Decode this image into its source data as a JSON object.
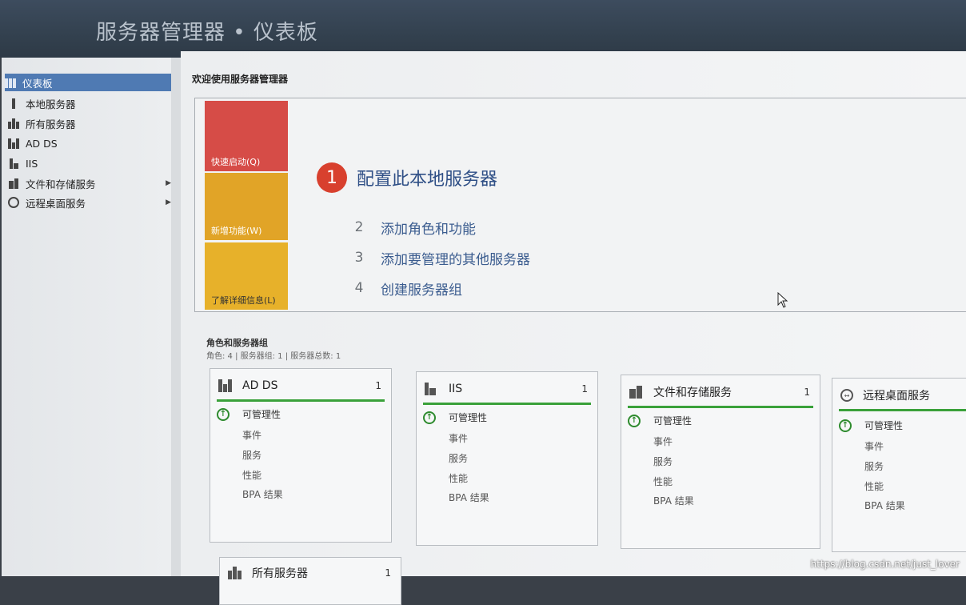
{
  "window": {
    "title": "服务器管理器 • 仪表板"
  },
  "sidebar": {
    "items": [
      {
        "label": "仪表板",
        "icon": "dashboard-icon",
        "active": true
      },
      {
        "label": "本地服务器",
        "icon": "server-icon"
      },
      {
        "label": "所有服务器",
        "icon": "servers-icon"
      },
      {
        "label": "AD DS",
        "icon": "ad-ds-icon"
      },
      {
        "label": "IIS",
        "icon": "iis-icon"
      },
      {
        "label": "文件和存储服务",
        "icon": "storage-icon",
        "expandable": true
      },
      {
        "label": "远程桌面服务",
        "icon": "remote-desktop-icon",
        "expandable": true
      }
    ]
  },
  "welcome": {
    "title": "欢迎使用服务器管理器",
    "tiles": [
      "快速启动(Q)",
      "新增功能(W)",
      "了解详细信息(L)"
    ],
    "steps": [
      {
        "num": "1",
        "label": "配置此本地服务器"
      },
      {
        "num": "2",
        "label": "添加角色和功能"
      },
      {
        "num": "3",
        "label": "添加要管理的其他服务器"
      },
      {
        "num": "4",
        "label": "创建服务器组"
      }
    ]
  },
  "roles": {
    "title": "角色和服务器组",
    "subtitle": "角色: 4 | 服务器组: 1 | 服务器总数: 1",
    "cards": [
      {
        "name": "AD DS",
        "count": "1",
        "rows": [
          "可管理性",
          "事件",
          "服务",
          "性能",
          "BPA 结果"
        ]
      },
      {
        "name": "IIS",
        "count": "1",
        "rows": [
          "可管理性",
          "事件",
          "服务",
          "性能",
          "BPA 结果"
        ]
      },
      {
        "name": "文件和存储服务",
        "count": "1",
        "rows": [
          "可管理性",
          "事件",
          "服务",
          "性能",
          "BPA 结果"
        ]
      },
      {
        "name": "远程桌面服务",
        "count": "",
        "rows": [
          "可管理性",
          "事件",
          "服务",
          "性能",
          "BPA 结果"
        ]
      },
      {
        "name": "所有服务器",
        "count": "1"
      }
    ]
  },
  "watermark": "https://blog.csdn.net/just_lover",
  "colors": {
    "accent": "#4f7ab3",
    "tile1": "#d64c47",
    "tile2": "#e1a427",
    "ok": "#3aa13a"
  }
}
